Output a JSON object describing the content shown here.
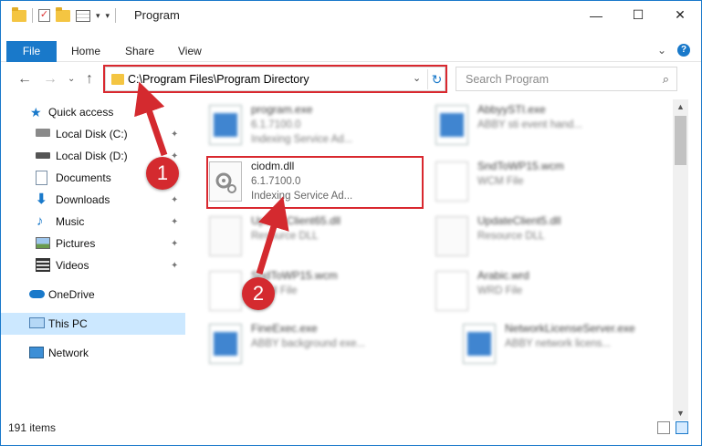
{
  "window": {
    "title": "Program",
    "buttons": {
      "minimize": "—",
      "maximize": "☐",
      "close": "✕"
    }
  },
  "ribbon": {
    "tabs": [
      "File",
      "Home",
      "Share",
      "View"
    ],
    "help": "?",
    "expand": "⌄"
  },
  "nav": {
    "back": "←",
    "forward": "→",
    "recent": "⌄",
    "up": "↑"
  },
  "address": {
    "path": "C:\\Program Files\\Program Directory",
    "dropdown": "⌄",
    "refresh": "↻"
  },
  "search": {
    "placeholder": "Search Program",
    "icon": "⌕"
  },
  "sidebar": {
    "items": [
      {
        "label": "Quick access",
        "icon": "star-icon",
        "pinned": false
      },
      {
        "label": "Local Disk (C:)",
        "icon": "drive-icon",
        "pinned": true
      },
      {
        "label": "Local Disk (D:)",
        "icon": "drive-icon",
        "pinned": true
      },
      {
        "label": "Documents",
        "icon": "documents-icon",
        "pinned": true
      },
      {
        "label": "Downloads",
        "icon": "download-icon",
        "pinned": true
      },
      {
        "label": "Music",
        "icon": "music-icon",
        "pinned": true
      },
      {
        "label": "Pictures",
        "icon": "pictures-icon",
        "pinned": true
      },
      {
        "label": "Videos",
        "icon": "videos-icon",
        "pinned": true
      },
      {
        "label": "OneDrive",
        "icon": "cloud-icon",
        "pinned": false
      },
      {
        "label": "This PC",
        "icon": "computer-icon",
        "pinned": false,
        "selected": true
      },
      {
        "label": "Network",
        "icon": "network-icon",
        "pinned": false
      }
    ],
    "pin_glyph": "📌"
  },
  "files": [
    {
      "name": "program.exe",
      "line2": "6.1.7100.0",
      "line3": "Indexing Service Ad...",
      "icon": "exe-icon",
      "blurred": true
    },
    {
      "name": "AbbyySTI.exe",
      "line2": "ABBY sti event hand...",
      "line3": "",
      "icon": "exe-icon",
      "blurred": true
    },
    {
      "name": "ciodm.dll",
      "line2": "6.1.7100.0",
      "line3": "Indexing Service Ad...",
      "icon": "dll-gear-icon",
      "blurred": false
    },
    {
      "name": "SndToWP15.wcm",
      "line2": "WCM File",
      "line3": "",
      "icon": "document-icon",
      "blurred": true
    },
    {
      "name": "UpdateClient65.dll",
      "line2": "Resource DLL",
      "line3": "",
      "icon": "dll-gear-icon",
      "blurred": true
    },
    {
      "name": "UpdateClient5.dll",
      "line2": "Resource DLL",
      "line3": "",
      "icon": "dll-gear-icon",
      "blurred": true
    },
    {
      "name": "SndToWP15.wcm",
      "line2": "WCM File",
      "line3": "",
      "icon": "document-icon",
      "blurred": true
    },
    {
      "name": "Arabic.wrd",
      "line2": "WRD File",
      "line3": "",
      "icon": "document-icon",
      "blurred": true
    },
    {
      "name": "FineExec.exe",
      "line2": "ABBY background exe...",
      "line3": "",
      "icon": "exe-icon",
      "blurred": true
    },
    {
      "name": "NetworkLicenseServer.exe",
      "line2": "ABBY network licens...",
      "line3": "",
      "icon": "exe-icon",
      "blurred": true
    }
  ],
  "status": {
    "count": "191 items"
  },
  "annotations": [
    {
      "number": "1"
    },
    {
      "number": "2"
    }
  ],
  "colors": {
    "accent": "#1979ca",
    "annotation_red": "#d9282f",
    "selected_bg": "#cce8ff"
  }
}
